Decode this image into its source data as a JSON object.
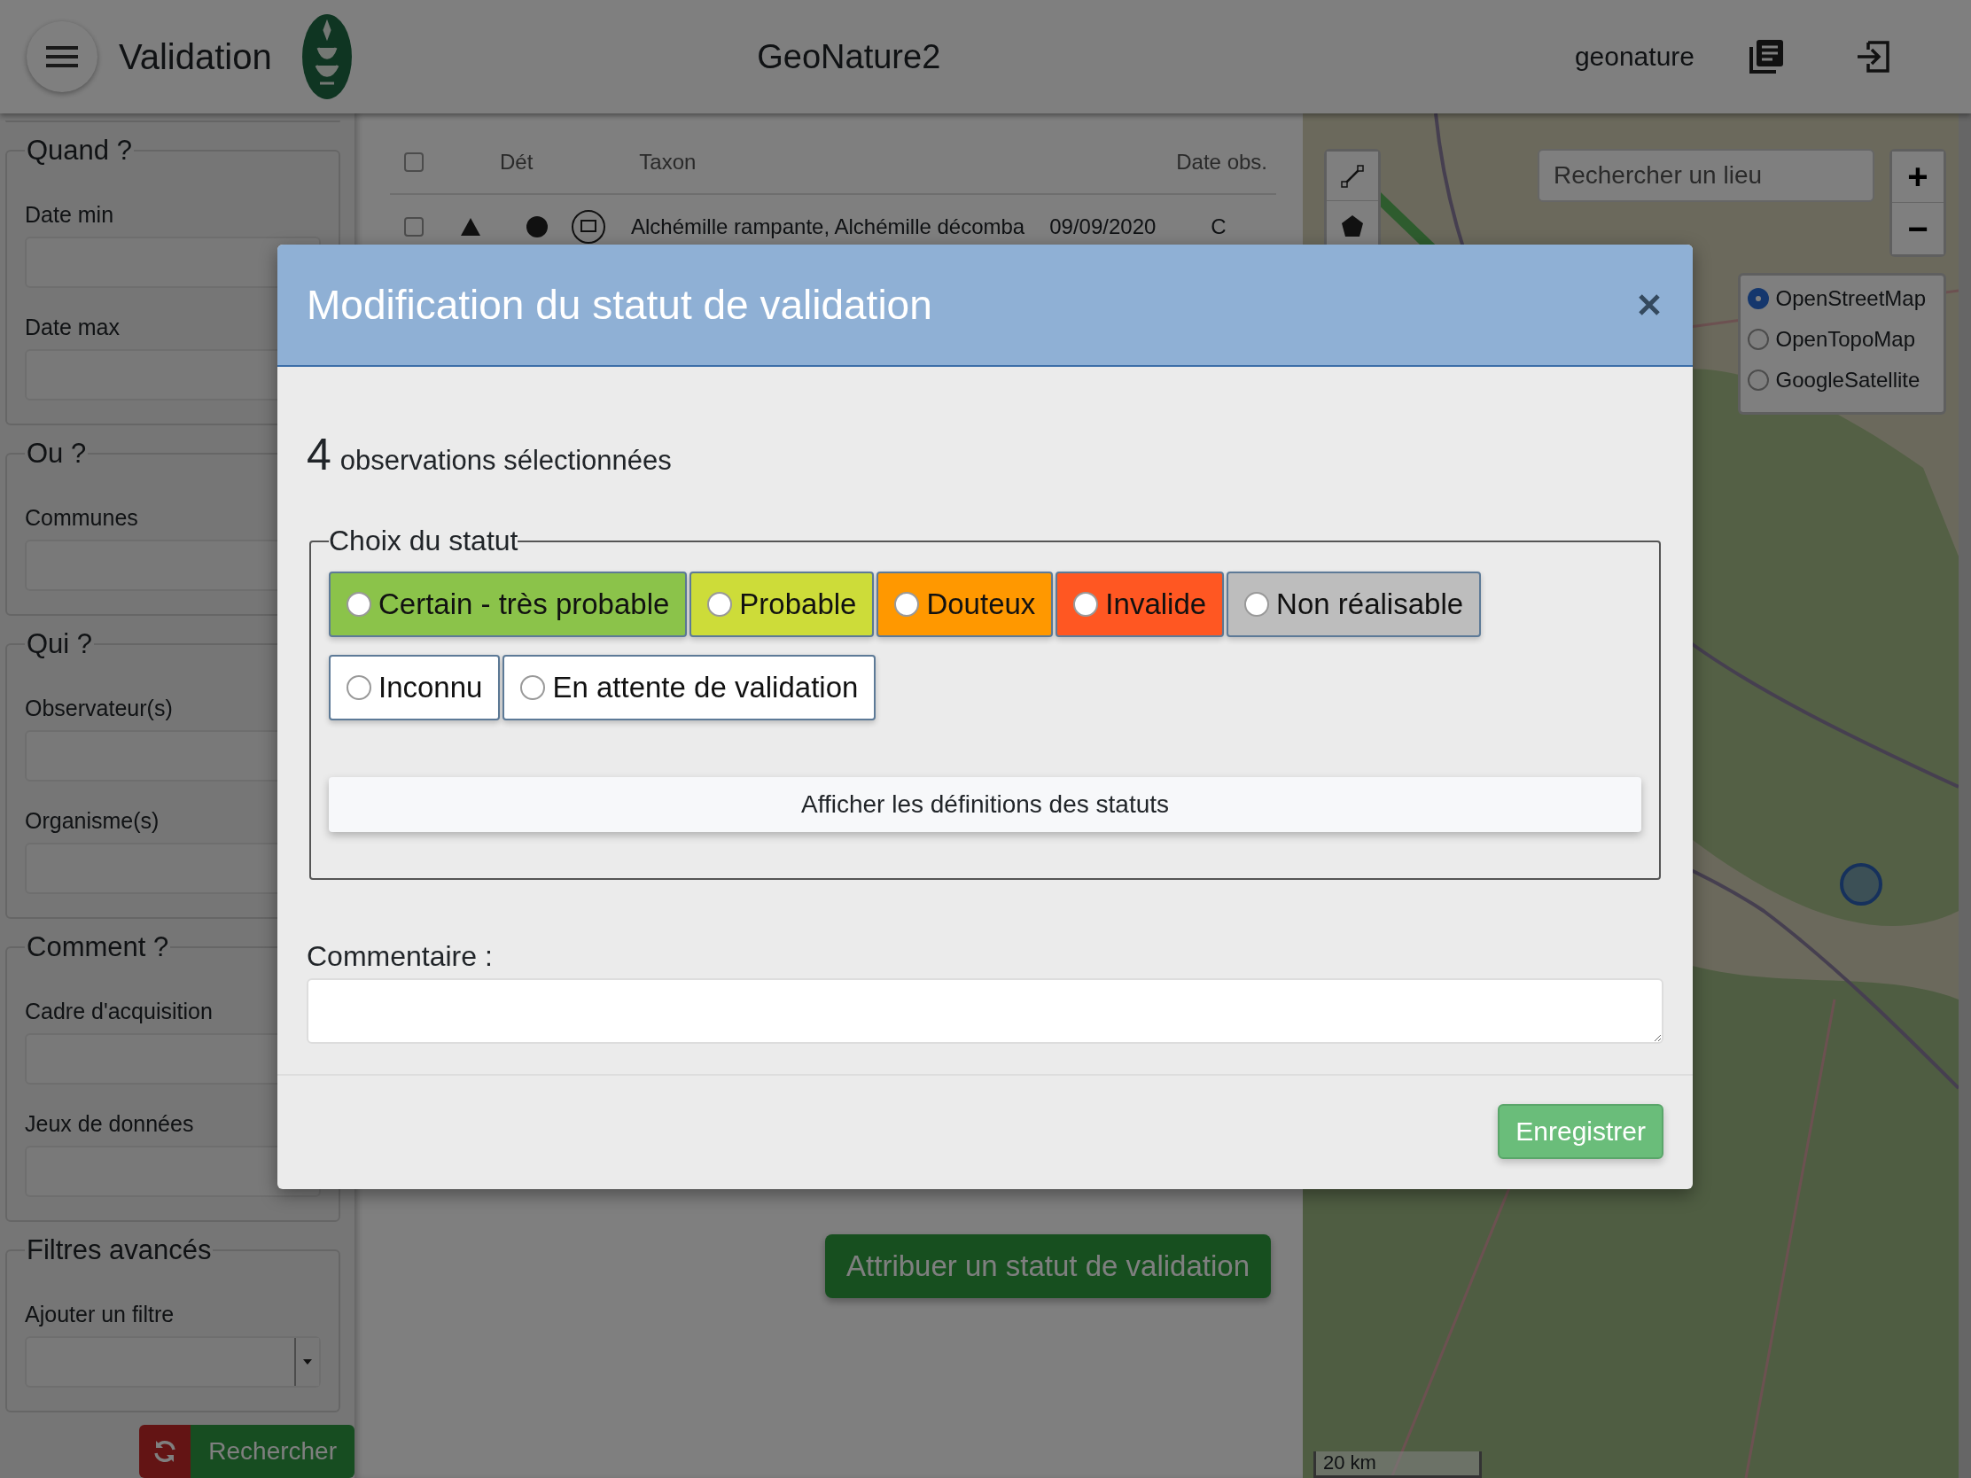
{
  "app_bar": {
    "title": "Validation",
    "app_name": "GeoNature2",
    "user": "geonature"
  },
  "filters": {
    "sections": [
      {
        "legend": "Quand ?",
        "fields": [
          {
            "label": "Date min",
            "kind": "input"
          },
          {
            "label": "Date max",
            "kind": "input"
          }
        ]
      },
      {
        "legend": "Ou ?",
        "fields": [
          {
            "label": "Communes",
            "kind": "input"
          }
        ]
      },
      {
        "legend": "Qui ?",
        "fields": [
          {
            "label": "Observateur(s)",
            "kind": "input"
          },
          {
            "label": "Organisme(s)",
            "kind": "input"
          }
        ]
      },
      {
        "legend": "Comment ?",
        "fields": [
          {
            "label": "Cadre d'acquisition",
            "kind": "input"
          },
          {
            "label": "Jeux de données",
            "kind": "input"
          }
        ]
      },
      {
        "legend": "Filtres avancés",
        "fields": [
          {
            "label": "Ajouter un filtre",
            "kind": "select"
          }
        ]
      }
    ],
    "search_button": "Rechercher"
  },
  "table": {
    "header_checked": false,
    "columns": [
      "Dét",
      "Taxon",
      "Date obs."
    ],
    "rows": [
      {
        "checked": false,
        "taxon": "Alchémille rampante, Alchémille décomba",
        "date": "09/09/2020",
        "column_6": "C"
      }
    ]
  },
  "assign_button": "Attribuer un statut de validation",
  "map": {
    "search": {
      "placeholder": "Rechercher un lieu"
    },
    "zoom_in": "+",
    "zoom_out": "−",
    "layers": [
      {
        "label": "OpenStreetMap",
        "selected": true
      },
      {
        "label": "OpenTopoMap",
        "selected": false
      },
      {
        "label": "GoogleSatellite",
        "selected": false
      }
    ],
    "scale": "20 km"
  },
  "modal": {
    "title": "Modification du statut de validation",
    "count": "4",
    "count_label": "observations sélectionnées",
    "status_legend": "Choix du statut",
    "statuses": [
      {
        "label": "Certain - très probable",
        "color": "#8bc34a",
        "selected": false
      },
      {
        "label": "Probable",
        "color": "#cddc39",
        "selected": false
      },
      {
        "label": "Douteux",
        "color": "#ff9800",
        "selected": false
      },
      {
        "label": "Invalide",
        "color": "#ff5722",
        "selected": false
      },
      {
        "label": "Non réalisable",
        "color": "#bdbdbd",
        "selected": false
      },
      {
        "label": "Inconnu",
        "color": "#ffffff",
        "selected": false
      },
      {
        "label": "En attente de validation",
        "color": "#ffffff",
        "selected": false
      }
    ],
    "definitions_button": "Afficher les définitions des statuts",
    "comment_label": "Commentaire :",
    "save_button": "Enregistrer"
  }
}
